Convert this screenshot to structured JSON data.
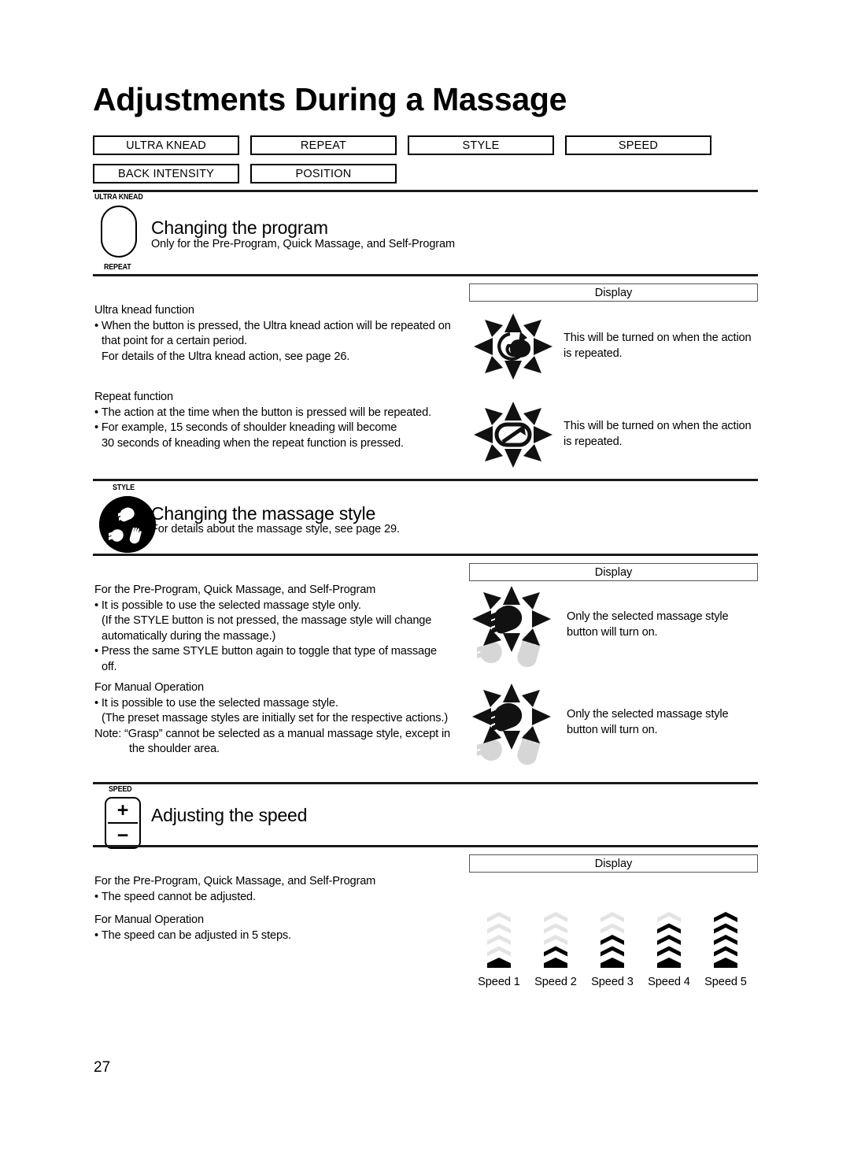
{
  "page": {
    "title": "Adjustments During a Massage",
    "number": "27"
  },
  "tabs": {
    "row1": [
      {
        "label": "ULTRA KNEAD"
      },
      {
        "label": "REPEAT"
      },
      {
        "label": "STYLE"
      },
      {
        "label": "SPEED"
      }
    ],
    "row2": [
      {
        "label": "BACK INTENSITY"
      },
      {
        "label": "POSITION"
      }
    ]
  },
  "sections": [
    {
      "id": "program",
      "button_label_top": "ULTRA KNEAD",
      "button_label_bottom": "REPEAT",
      "icon": "pill-button-icon",
      "title": "Changing the program",
      "subtitle": "Only for the Pre-Program, Quick Massage, and Self-Program",
      "display_header": "Display",
      "blocks": [
        {
          "heading": "Ultra knead function",
          "lines": [
            {
              "type": "bullet",
              "text": "When the button is pressed, the Ultra knead action will be repeated on"
            },
            {
              "type": "cont",
              "text": "that point for a certain period."
            },
            {
              "type": "cont",
              "text": "For details of the Ultra knead action, see page 26."
            }
          ]
        },
        {
          "heading": "Repeat function",
          "lines": [
            {
              "type": "bullet",
              "text": "The action at the time when the button is pressed will be repeated."
            },
            {
              "type": "bullet",
              "text": "For example, 15 seconds of shoulder kneading will become"
            },
            {
              "type": "cont",
              "text": "30 seconds of kneading when the repeat function is pressed."
            }
          ]
        }
      ],
      "displays": [
        {
          "icon": "ultra-knead-burst-icon",
          "text_line1": "This will be turned on when the action",
          "text_line2": "is repeated."
        },
        {
          "icon": "repeat-loop-burst-icon",
          "text_line1": "This will be turned on when the action",
          "text_line2": "is repeated."
        }
      ]
    },
    {
      "id": "style",
      "button_label_top": "STYLE",
      "icon": "style-hands-circle-icon",
      "title": "Changing the massage style",
      "subtitle": "For details about the massage style, see page 29.",
      "display_header": "Display",
      "blocks": [
        {
          "heading": "For the Pre-Program, Quick Massage, and Self-Program",
          "lines": [
            {
              "type": "bullet",
              "text": "It is possible to use the selected massage style only."
            },
            {
              "type": "cont",
              "text": "(If the STYLE button is not pressed, the massage style will change"
            },
            {
              "type": "cont",
              "text": "automatically during the massage.)"
            },
            {
              "type": "bullet",
              "text": "Press the same STYLE button again to toggle that type of massage"
            },
            {
              "type": "cont",
              "text": "off."
            }
          ]
        },
        {
          "heading": "For Manual Operation",
          "lines": [
            {
              "type": "bullet",
              "text": "It is possible to use the selected massage style."
            },
            {
              "type": "cont",
              "text": "(The preset massage styles are initially set for the respective actions.)"
            },
            {
              "type": "note",
              "text": "Note: “Grasp” cannot be selected as a manual massage style, except in"
            },
            {
              "type": "noteind",
              "text": "the shoulder area."
            }
          ]
        }
      ],
      "displays": [
        {
          "icon": "massage-style-burst-icon",
          "text_line1": "Only the selected massage style",
          "text_line2": "button will turn on."
        },
        {
          "icon": "massage-style-burst-icon",
          "text_line1": "Only the selected massage style",
          "text_line2": "button will turn on."
        }
      ]
    },
    {
      "id": "speed",
      "button_label_top": "SPEED",
      "icon": "speed-plus-minus-icon",
      "plus": "+",
      "minus": "−",
      "title": "Adjusting the speed",
      "subtitle": "",
      "display_header": "Display",
      "blocks": [
        {
          "heading": "For the Pre-Program, Quick Massage, and Self-Program",
          "lines": [
            {
              "type": "bullet",
              "text": "The speed cannot be adjusted."
            }
          ]
        },
        {
          "heading": "For Manual Operation",
          "lines": [
            {
              "type": "bullet",
              "text": "The speed can be adjusted in 5 steps."
            }
          ]
        }
      ],
      "speed_steps": [
        {
          "label": "Speed 1",
          "filled": 1,
          "total": 5
        },
        {
          "label": "Speed 2",
          "filled": 2,
          "total": 5
        },
        {
          "label": "Speed 3",
          "filled": 3,
          "total": 5
        },
        {
          "label": "Speed 4",
          "filled": 4,
          "total": 5
        },
        {
          "label": "Speed 5",
          "filled": 5,
          "total": 5
        }
      ]
    }
  ],
  "colors": {
    "ink": "#000000",
    "rule": "#1a1a1a",
    "box_border": "#555555",
    "chevron_off": "#e3e3e3",
    "chevron_on": "#000000",
    "hand_ghost": "#d6d6d6"
  }
}
